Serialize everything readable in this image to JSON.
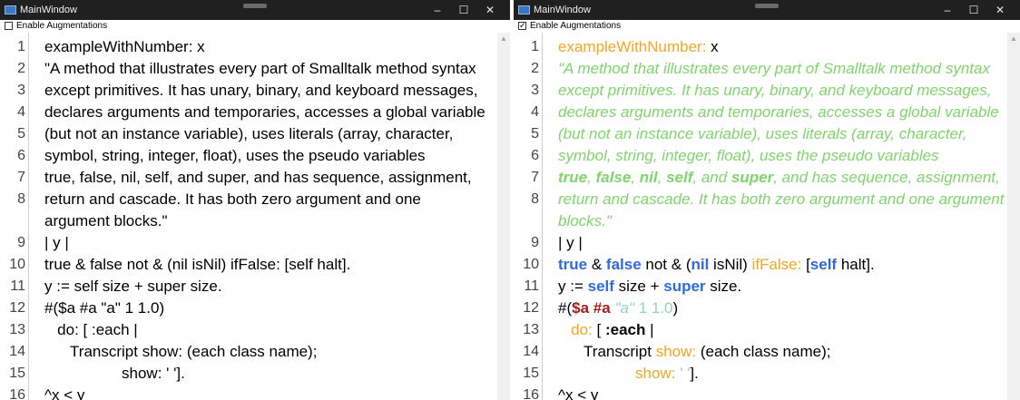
{
  "windows": [
    {
      "title": "MainWindow",
      "controls": {
        "minimize": "–",
        "maximize": "☐",
        "close": "✕"
      },
      "augment": {
        "label": "Enable Augmentations",
        "checked": false,
        "mark": ""
      },
      "lines": [
        {
          "n": "1",
          "segs": [
            {
              "t": "exampleWithNumber: x"
            }
          ]
        },
        {
          "n": "2",
          "segs": [
            {
              "t": "\"A method that illustrates every part of Smalltalk method syntax"
            }
          ]
        },
        {
          "n": "3",
          "segs": [
            {
              "t": "except primitives. It has unary, binary, and keyboard messages,"
            }
          ]
        },
        {
          "n": "4",
          "segs": [
            {
              "t": "declares arguments and temporaries, accesses a global variable"
            }
          ]
        },
        {
          "n": "5",
          "segs": [
            {
              "t": "(but not an instance variable), uses literals (array, character,"
            }
          ]
        },
        {
          "n": "6",
          "segs": [
            {
              "t": "symbol, string, integer, float), uses the pseudo variables"
            }
          ]
        },
        {
          "n": "7",
          "segs": [
            {
              "t": "true, false, nil, self, and super, and has sequence, assignment,"
            }
          ]
        },
        {
          "n": "8",
          "segs": [
            {
              "t": "return and cascade. It has both zero argument and one"
            }
          ]
        },
        {
          "n": "",
          "segs": [
            {
              "t": "argument blocks.\""
            }
          ]
        },
        {
          "n": "9",
          "segs": [
            {
              "t": "| y |"
            }
          ]
        },
        {
          "n": "10",
          "segs": [
            {
              "t": "true & false not & (nil isNil) ifFalse: [self halt]."
            }
          ]
        },
        {
          "n": "11",
          "segs": [
            {
              "t": "y := self size + super size."
            }
          ]
        },
        {
          "n": "12",
          "segs": [
            {
              "t": "#($a #a \"a\" 1 1.0)"
            }
          ]
        },
        {
          "n": "13",
          "segs": [
            {
              "t": "   do: [ :each |"
            }
          ]
        },
        {
          "n": "14",
          "segs": [
            {
              "t": "      Transcript show: (each class name);"
            }
          ]
        },
        {
          "n": "15",
          "segs": [
            {
              "t": "                  show: ' ']."
            }
          ]
        },
        {
          "n": "16",
          "segs": [
            {
              "t": "^x < y"
            }
          ]
        }
      ]
    },
    {
      "title": "MainWindow",
      "controls": {
        "minimize": "–",
        "maximize": "☐",
        "close": "✕"
      },
      "augment": {
        "label": "Enable Augmentations",
        "checked": true,
        "mark": "✓"
      },
      "lines": [
        {
          "n": "1",
          "segs": [
            {
              "t": "exampleWithNumber:",
              "c": "k-sel"
            },
            {
              "t": " x"
            }
          ]
        },
        {
          "n": "2",
          "segs": [
            {
              "t": "\"A method that illustrates every part of Smalltalk method syntax",
              "c": "k-com"
            }
          ]
        },
        {
          "n": "3",
          "segs": [
            {
              "t": "except primitives. It has unary, binary, and keyboard messages,",
              "c": "k-com"
            }
          ]
        },
        {
          "n": "4",
          "segs": [
            {
              "t": "declares arguments and temporaries, accesses a global variable",
              "c": "k-com"
            }
          ]
        },
        {
          "n": "5",
          "segs": [
            {
              "t": "(but not an instance variable), uses literals (array, character,",
              "c": "k-com"
            }
          ]
        },
        {
          "n": "6",
          "segs": [
            {
              "t": "symbol, string, integer, float), uses the pseudo variables",
              "c": "k-com"
            }
          ]
        },
        {
          "n": "7",
          "segs": [
            {
              "t": "true",
              "c": "k-comb"
            },
            {
              "t": ", ",
              "c": "k-com"
            },
            {
              "t": "false",
              "c": "k-comb"
            },
            {
              "t": ", ",
              "c": "k-com"
            },
            {
              "t": "nil",
              "c": "k-comb"
            },
            {
              "t": ", ",
              "c": "k-com"
            },
            {
              "t": "self",
              "c": "k-comb"
            },
            {
              "t": ", and ",
              "c": "k-com"
            },
            {
              "t": "super",
              "c": "k-comb"
            },
            {
              "t": ", and has sequence, assignment,",
              "c": "k-com"
            }
          ]
        },
        {
          "n": "8",
          "segs": [
            {
              "t": "return and cascade. It has both zero argument and one argument",
              "c": "k-com"
            }
          ]
        },
        {
          "n": "",
          "segs": [
            {
              "t": "blocks.\"",
              "c": "k-com"
            }
          ]
        },
        {
          "n": "9",
          "segs": [
            {
              "t": "| y |"
            }
          ]
        },
        {
          "n": "10",
          "segs": [
            {
              "t": "true",
              "c": "k-blue"
            },
            {
              "t": " & "
            },
            {
              "t": "false",
              "c": "k-blue"
            },
            {
              "t": " not & ("
            },
            {
              "t": "nil",
              "c": "k-blue"
            },
            {
              "t": " isNil) "
            },
            {
              "t": "ifFalse:",
              "c": "k-sel"
            },
            {
              "t": " ["
            },
            {
              "t": "self",
              "c": "k-blue"
            },
            {
              "t": " halt]."
            }
          ]
        },
        {
          "n": "11",
          "segs": [
            {
              "t": "y := "
            },
            {
              "t": "self",
              "c": "k-blue"
            },
            {
              "t": " size + "
            },
            {
              "t": "super",
              "c": "k-blue"
            },
            {
              "t": " size."
            }
          ]
        },
        {
          "n": "12",
          "segs": [
            {
              "t": "#("
            },
            {
              "t": "$a",
              "c": "k-red"
            },
            {
              "t": " "
            },
            {
              "t": "#a",
              "c": "k-red"
            },
            {
              "t": " "
            },
            {
              "t": "\"a\"",
              "c": "k-mint"
            },
            {
              "t": " "
            },
            {
              "t": "1 1.0",
              "c": "k-num"
            },
            {
              "t": ")"
            }
          ]
        },
        {
          "n": "13",
          "segs": [
            {
              "t": "   "
            },
            {
              "t": "do:",
              "c": "k-sel"
            },
            {
              "t": " [ "
            },
            {
              "t": ":each",
              "c": "k-blk"
            },
            {
              "t": " |"
            }
          ]
        },
        {
          "n": "14",
          "segs": [
            {
              "t": "      Transcript "
            },
            {
              "t": "show:",
              "c": "k-sel"
            },
            {
              "t": " (each class name);"
            }
          ]
        },
        {
          "n": "15",
          "segs": [
            {
              "t": "                  "
            },
            {
              "t": "show:",
              "c": "k-sel"
            },
            {
              "t": " "
            },
            {
              "t": "' '",
              "c": "k-num"
            },
            {
              "t": "]."
            }
          ]
        },
        {
          "n": "16",
          "segs": [
            {
              "t": "^x < y"
            }
          ]
        }
      ]
    }
  ]
}
